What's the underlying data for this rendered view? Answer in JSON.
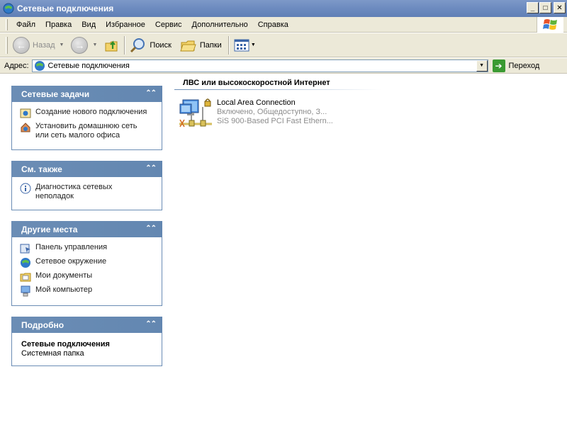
{
  "window": {
    "title": "Сетевые подключения",
    "controls": {
      "minimize": "_",
      "maximize": "□",
      "close": "✕"
    }
  },
  "menu": [
    "Файл",
    "Правка",
    "Вид",
    "Избранное",
    "Сервис",
    "Дополнительно",
    "Справка"
  ],
  "toolbar": {
    "back_label": "Назад",
    "search_label": "Поиск",
    "folders_label": "Папки"
  },
  "address": {
    "label": "Адрес:",
    "value": "Сетевые подключения",
    "go_label": "Переход"
  },
  "panels": {
    "network_tasks": {
      "title": "Сетевые задачи",
      "items": [
        {
          "label": "Создание нового подключения",
          "icon": "new-connection-icon"
        },
        {
          "label": "Установить домашнюю сеть или сеть малого офиса",
          "icon": "home-network-icon"
        }
      ]
    },
    "see_also": {
      "title": "См. также",
      "items": [
        {
          "label": "Диагностика сетевых неполадок",
          "icon": "info-icon"
        }
      ]
    },
    "other_places": {
      "title": "Другие места",
      "items": [
        {
          "label": "Панель управления",
          "icon": "control-panel-icon"
        },
        {
          "label": "Сетевое окружение",
          "icon": "network-places-icon"
        },
        {
          "label": "Мои документы",
          "icon": "my-documents-icon"
        },
        {
          "label": "Мой компьютер",
          "icon": "my-computer-icon"
        }
      ]
    },
    "details": {
      "title": "Подробно",
      "name": "Сетевые подключения",
      "type": "Системная папка"
    }
  },
  "content": {
    "group_title": "ЛВС или высокоскоростной Интернет",
    "connections": [
      {
        "name": "Local Area Connection",
        "status": "Включено, Общедоступно, З...",
        "adapter": "SiS 900-Based PCI Fast Ethern..."
      }
    ]
  },
  "colors": {
    "titlebar": "#7d99c8",
    "panel_header": "#6b8db5",
    "chrome": "#ece9d8"
  }
}
